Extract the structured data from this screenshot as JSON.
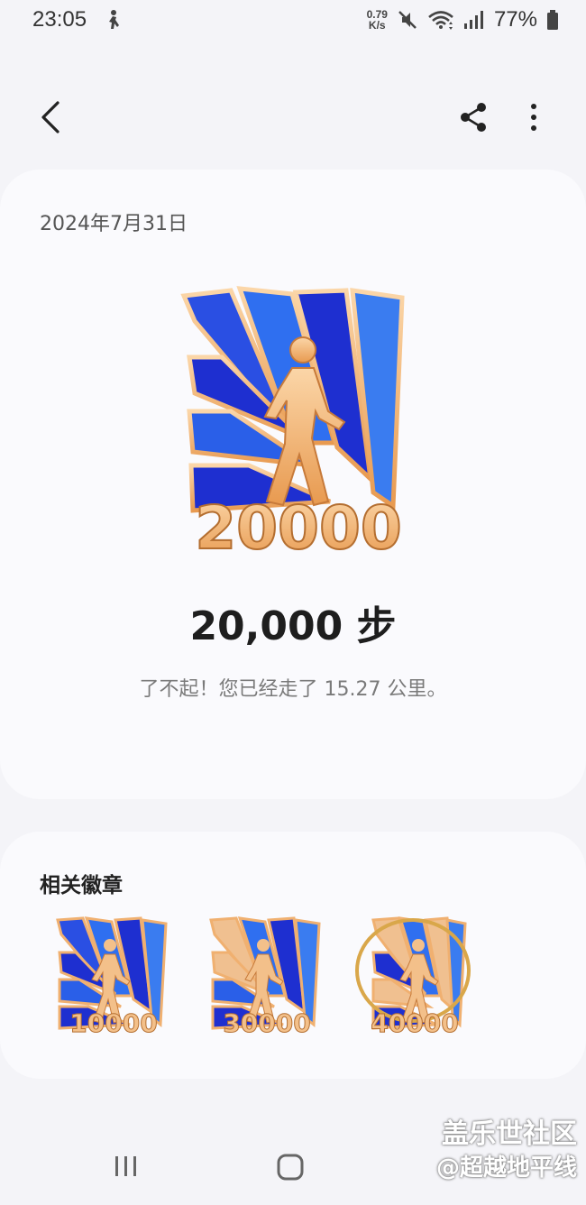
{
  "status_bar": {
    "time": "23:05",
    "net_speed_value": "0.79",
    "net_speed_unit": "K/s",
    "battery": "77%",
    "icons": [
      "mute-icon",
      "wifi-icon",
      "signal-icon",
      "battery-icon"
    ]
  },
  "toolbar": {
    "back_icon": "chevron-left-icon",
    "share_icon": "share-icon",
    "more_icon": "more-vertical-icon"
  },
  "achievement": {
    "date": "2024年7月31日",
    "badge_number": "20000",
    "steps_title": "20,000 步",
    "message": "了不起！您已经走了 15.27 公里。"
  },
  "related": {
    "title": "相关徽章",
    "badges": [
      {
        "number": "10000"
      },
      {
        "number": "30000"
      },
      {
        "number": "40000"
      }
    ]
  },
  "watermark": {
    "line1": "盖乐世社区",
    "line2": "@超越地平线"
  },
  "colors": {
    "background": "#f4f4f8",
    "card": "#fafafd",
    "badge_blue_dark": "#1f2fd6",
    "badge_blue_light": "#2f6ff0",
    "badge_gold": "#f0b070"
  }
}
